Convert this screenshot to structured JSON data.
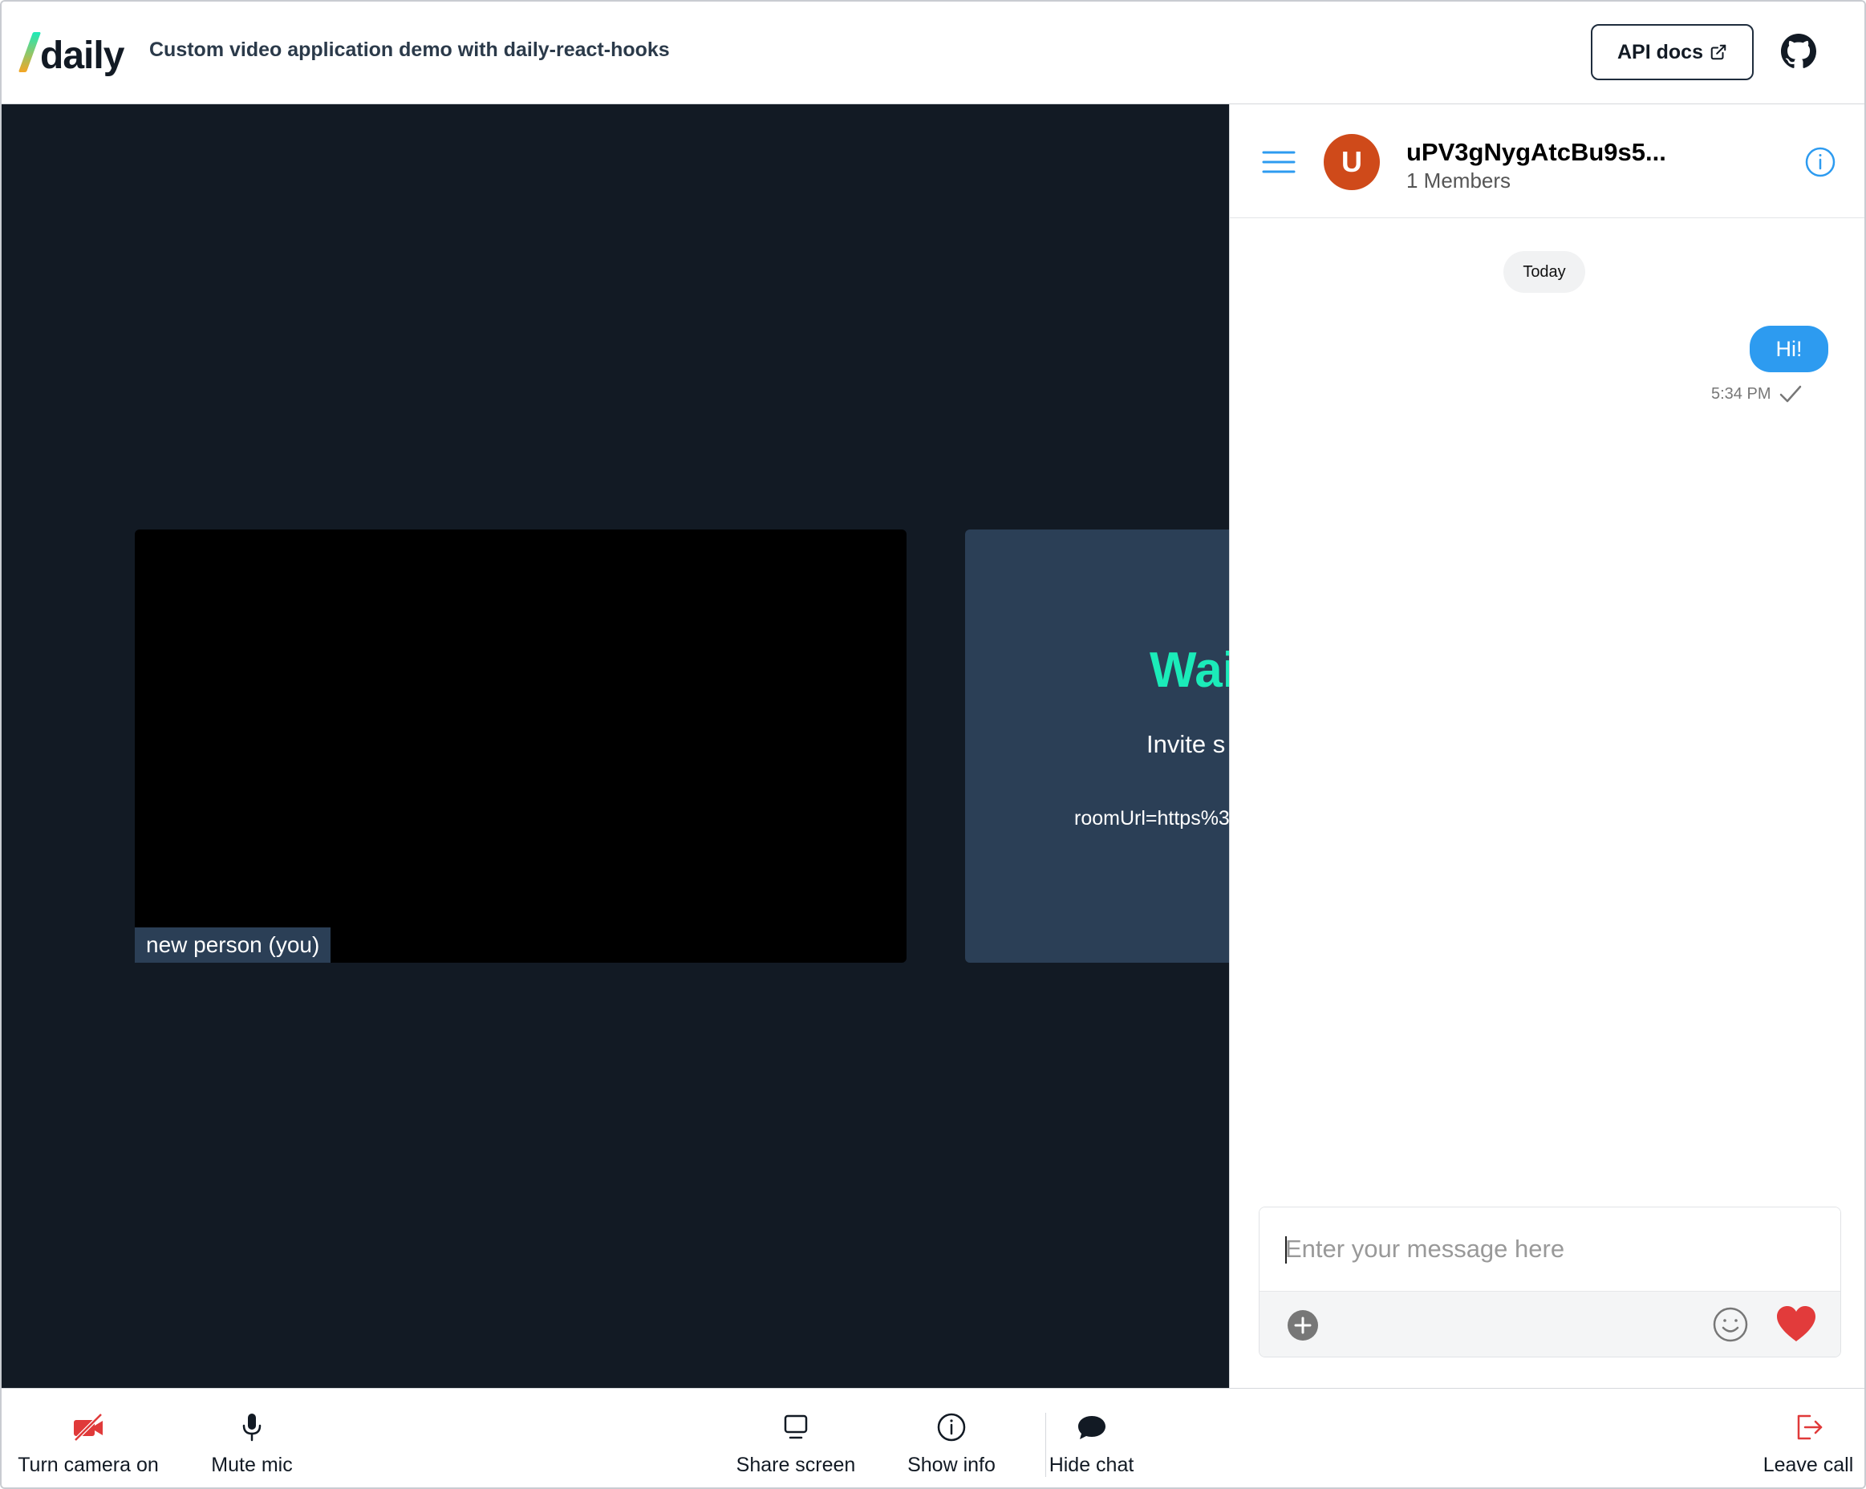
{
  "header": {
    "logo_text": "daily",
    "title": "Custom video application demo with daily-react-hooks",
    "api_docs_label": "API docs",
    "github_icon": "github-icon"
  },
  "call": {
    "local_tile_name": "new person (you)",
    "waiting_title": "Wai",
    "waiting_subtitle": "Invite s",
    "waiting_url": "roomUrl=https%3"
  },
  "chat": {
    "avatar_letter": "U",
    "room_name": "uPV3gNygAtcBu9s5...",
    "members": "1 Members",
    "date_divider": "Today",
    "messages": [
      {
        "text": "Hi!",
        "time": "5:34 PM",
        "status": "sent"
      }
    ],
    "composer": {
      "placeholder": "Enter your message here"
    },
    "colors": {
      "avatar": "#cf4a1a",
      "bubble": "#2d9bf0",
      "heart": "#e23b3b"
    }
  },
  "controls": {
    "camera_label": "Turn camera on",
    "mic_label": "Mute mic",
    "share_label": "Share screen",
    "info_label": "Show info",
    "chat_label": "Hide chat",
    "leave_label": "Leave call"
  },
  "colors": {
    "call_background": "#121a24",
    "waiting_tile": "#2b3f56",
    "accent_teal": "#1bebb9",
    "danger": "#e03a3a"
  }
}
